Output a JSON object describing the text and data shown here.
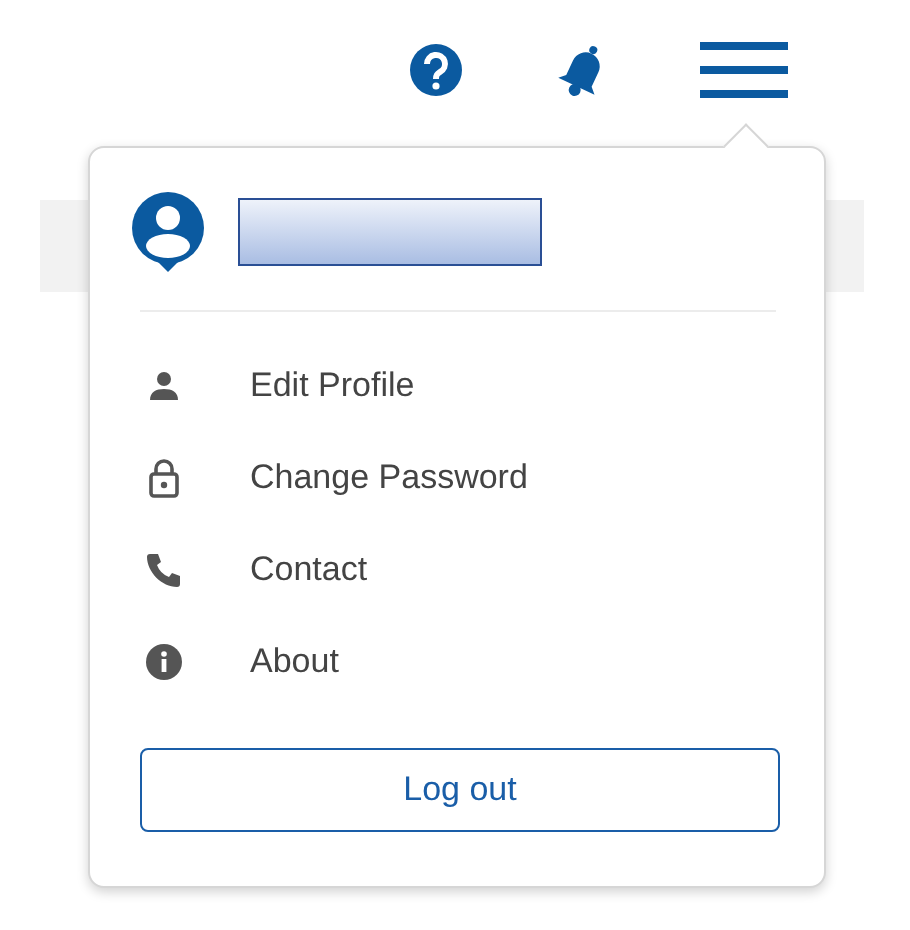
{
  "header": {
    "icons": [
      {
        "kind": "help"
      },
      {
        "kind": "bell"
      },
      {
        "kind": "menu",
        "expanded": true
      }
    ]
  },
  "user_menu": {
    "items": [
      {
        "kind": "person",
        "label": "Edit Profile"
      },
      {
        "kind": "lock",
        "label": "Change Password"
      },
      {
        "kind": "phone",
        "label": "Contact"
      },
      {
        "kind": "info",
        "label": "About"
      }
    ],
    "logout_button": "Log out"
  }
}
